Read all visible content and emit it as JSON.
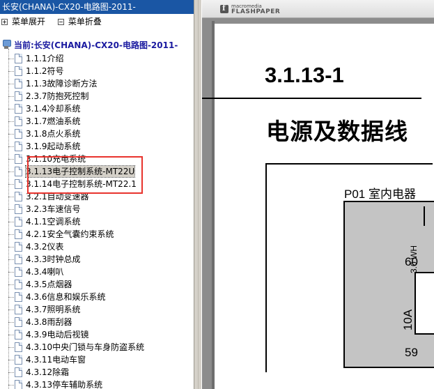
{
  "left_pane": {
    "title": "长安(CHANA)-CX20-电路图-2011-",
    "actions": {
      "expand": "菜单展开",
      "collapse": "菜单折叠"
    },
    "tree_root": "当前:长安(CHANA)-CX20-电路图-2011-",
    "tree_items": [
      "1.1.1介绍",
      "1.1.2符号",
      "1.1.3故障诊断方法",
      "2.3.7防抱死控制",
      "3.1.4冷却系统",
      "3.1.7燃油系统",
      "3.1.8点火系统",
      "3.1.9起动系统",
      "3.1.10充电系统",
      "3.1.13电子控制系统-MT22U",
      "3.1.14电子控制系统-MT22.1",
      "3.2.1自动变速器",
      "3.2.3车速信号",
      "4.1.1空调系统",
      "4.2.1安全气囊约束系统",
      "4.3.2仪表",
      "4.3.3时钟总成",
      "4.3.4喇叭",
      "4.3.5点烟器",
      "4.3.6信息和娱乐系统",
      "4.3.7照明系统",
      "4.3.8雨刮器",
      "4.3.9电动后视镜",
      "4.3.10中央门锁与车身防盗系统",
      "4.3.11电动车窗",
      "4.3.12除霜",
      "4.3.13停车辅助系统"
    ],
    "selected_index": 9
  },
  "viewer": {
    "logo_small": "macromedia",
    "logo_big": "FLASHPAPER",
    "page_number": "3.1.13-1",
    "page_heading": "电源及数据线",
    "p01_label": "P01 室内电器",
    "fuse_label": "10A",
    "wire_label": "3.0 WH",
    "pin_top": "60",
    "pin_bottom": "59"
  },
  "colors": {
    "title_bar": "#1a56a4",
    "highlight_box": "#e8332d",
    "viewer_bg": "#8c8c8c",
    "relay_fill": "#c4c4c4"
  }
}
